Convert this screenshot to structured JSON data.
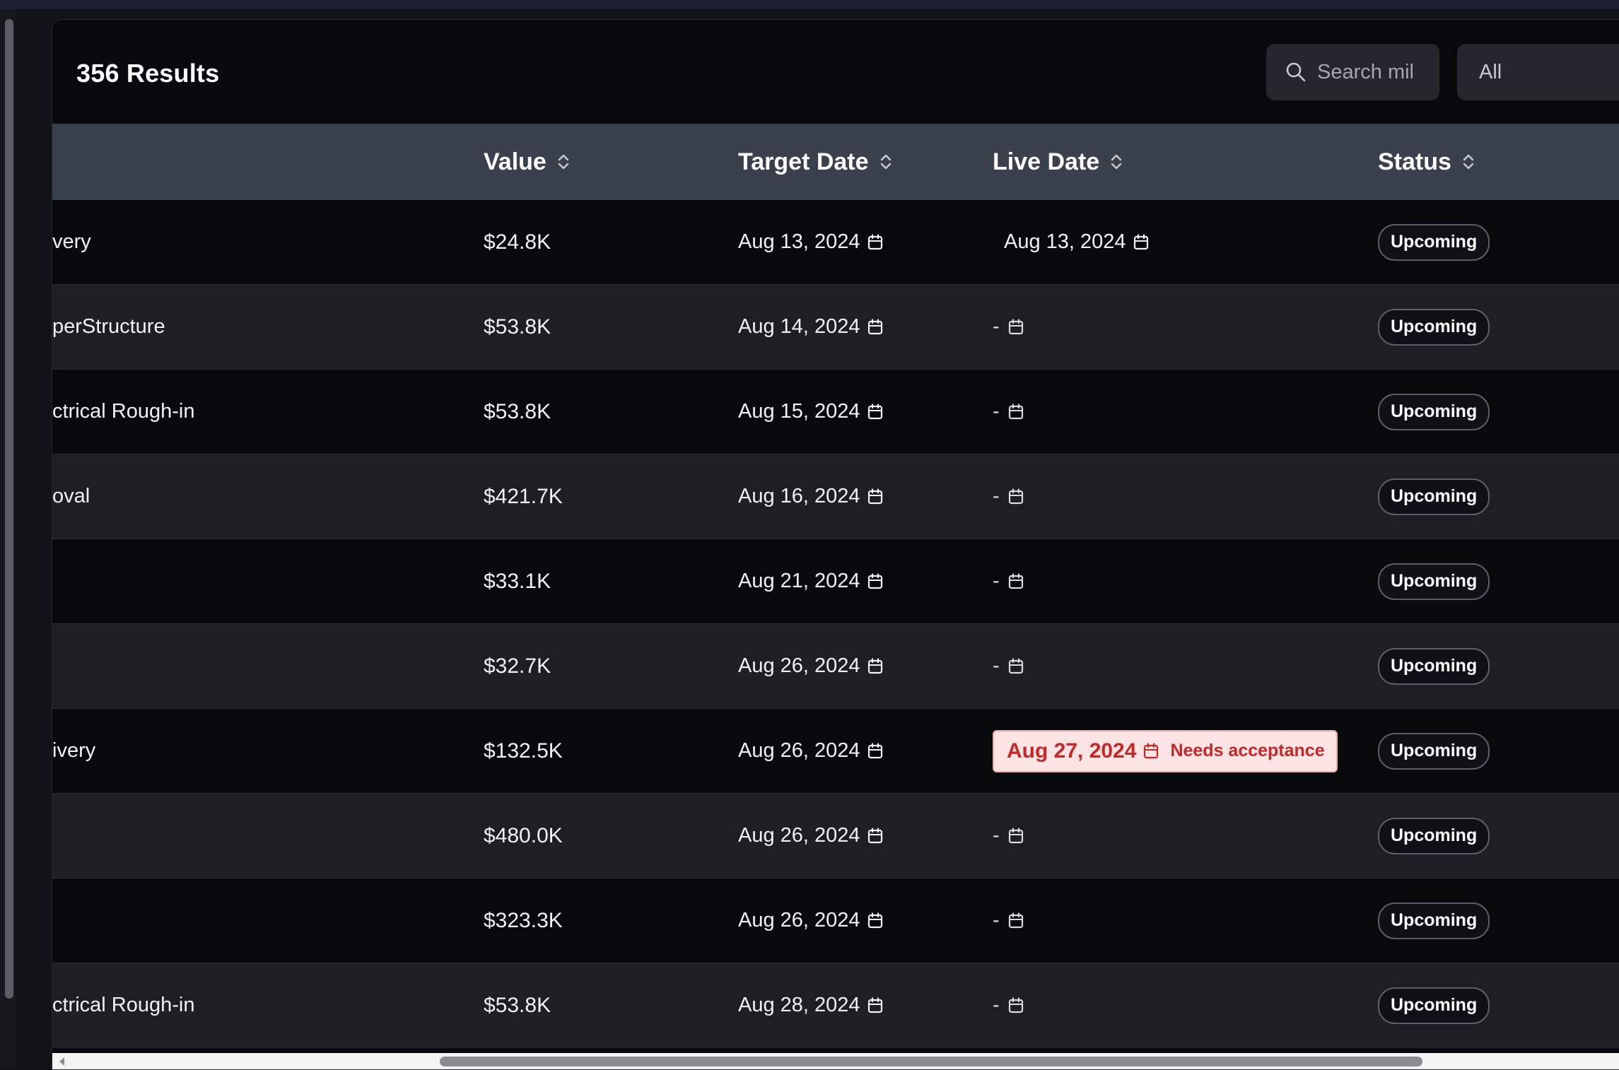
{
  "header": {
    "results_title": "356 Results",
    "search_placeholder": "Search mil",
    "filter_value": "All"
  },
  "columns": {
    "value": "Value",
    "target_date": "Target Date",
    "live_date": "Live Date",
    "status": "Status"
  },
  "rows": [
    {
      "name": "very",
      "value": "$24.8K",
      "target_date": "Aug 13, 2024",
      "live_date": "Aug 13, 2024",
      "status": "Upcoming"
    },
    {
      "name": "perStructure",
      "value": "$53.8K",
      "target_date": "Aug 14, 2024",
      "live_date": "-",
      "status": "Upcoming"
    },
    {
      "name": "ctrical Rough-in",
      "value": "$53.8K",
      "target_date": "Aug 15, 2024",
      "live_date": "-",
      "status": "Upcoming"
    },
    {
      "name": "oval",
      "value": "$421.7K",
      "target_date": "Aug 16, 2024",
      "live_date": "-",
      "status": "Upcoming"
    },
    {
      "name": "",
      "value": "$33.1K",
      "target_date": "Aug 21, 2024",
      "live_date": "-",
      "status": "Upcoming"
    },
    {
      "name": "",
      "value": "$32.7K",
      "target_date": "Aug 26, 2024",
      "live_date": "-",
      "status": "Upcoming"
    },
    {
      "name": "ivery",
      "value": "$132.5K",
      "target_date": "Aug 26, 2024",
      "live_date": "Aug 27, 2024",
      "live_note": "Needs acceptance",
      "status": "Upcoming"
    },
    {
      "name": "",
      "value": "$480.0K",
      "target_date": "Aug 26, 2024",
      "live_date": "-",
      "status": "Upcoming"
    },
    {
      "name": "",
      "value": "$323.3K",
      "target_date": "Aug 26, 2024",
      "live_date": "-",
      "status": "Upcoming"
    },
    {
      "name": "ctrical Rough-in",
      "value": "$53.8K",
      "target_date": "Aug 28, 2024",
      "live_date": "-",
      "status": "Upcoming"
    }
  ],
  "colors": {
    "header_bg": "#3b404d",
    "row_dark": "#08090b",
    "row_light": "#1d1f25",
    "warning_bg": "#fde4e4",
    "warning_text": "#c62828"
  },
  "icons": {
    "search": "search-icon",
    "sort": "sort-icon",
    "calendar": "calendar-icon",
    "scroll_left": "scroll-left-arrow-icon"
  }
}
